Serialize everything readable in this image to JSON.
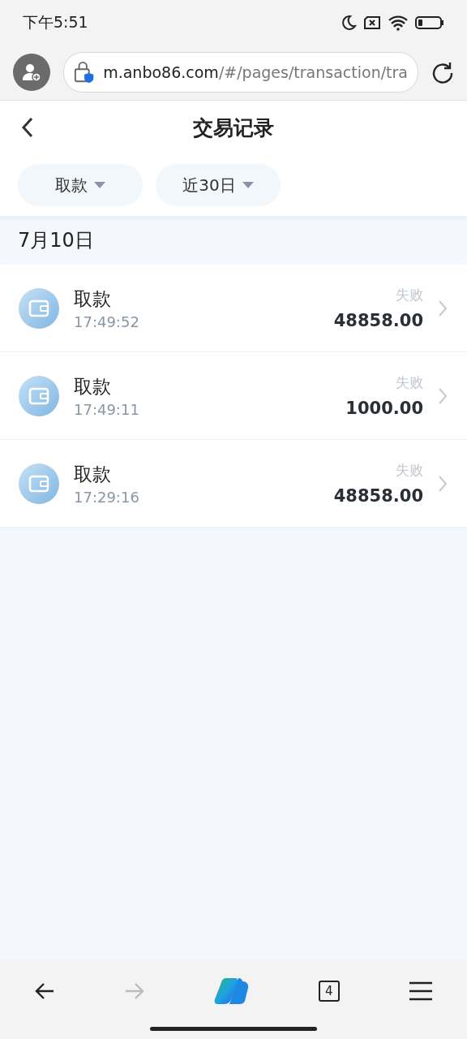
{
  "status_bar": {
    "time": "下午5:51"
  },
  "browser": {
    "url_host": "m.anbo86.com",
    "url_path": "/#/pages/transaction/tra"
  },
  "header": {
    "title": "交易记录"
  },
  "filters": [
    {
      "label": "取款"
    },
    {
      "label": "近30日"
    }
  ],
  "date_group": "7月10日",
  "transactions": [
    {
      "type": "取款",
      "time": "17:49:52",
      "status": "失败",
      "amount": "48858.00"
    },
    {
      "type": "取款",
      "time": "17:49:11",
      "status": "失败",
      "amount": "1000.00"
    },
    {
      "type": "取款",
      "time": "17:29:16",
      "status": "失败",
      "amount": "48858.00"
    }
  ],
  "bottom_nav": {
    "back_disabled": false,
    "forward_disabled": true,
    "tab_count": "4"
  }
}
